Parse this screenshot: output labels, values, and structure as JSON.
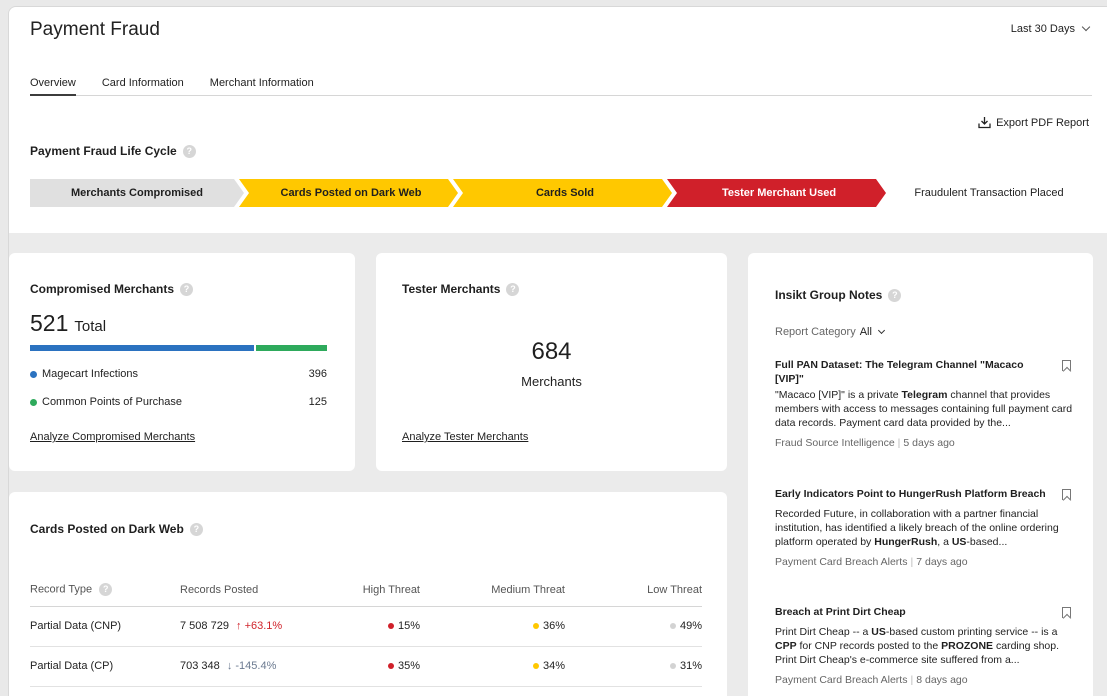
{
  "header": {
    "title": "Payment Fraud",
    "date_range": "Last 30 Days"
  },
  "tabs": [
    {
      "label": "Overview",
      "active": true
    },
    {
      "label": "Card Information",
      "active": false
    },
    {
      "label": "Merchant Information",
      "active": false
    }
  ],
  "export_label": "Export PDF Report",
  "lifecycle": {
    "title": "Payment Fraud Life Cycle",
    "stages": [
      {
        "label": "Merchants Compromised",
        "color": "#e0e0e0",
        "text_color": "#1f1f1f"
      },
      {
        "label": "Cards Posted on Dark Web",
        "color": "#ffc800",
        "text_color": "#1f1f1f"
      },
      {
        "label": "Cards Sold",
        "color": "#ffc800",
        "text_color": "#1f1f1f"
      },
      {
        "label": "Tester Merchant Used",
        "color": "#d0202a",
        "text_color": "#ffffff"
      },
      {
        "label": "Fraudulent Transaction Placed",
        "color": "#ffffff",
        "text_color": "#1f1f1f"
      }
    ]
  },
  "compromised": {
    "title": "Compromised Merchants",
    "total": "521",
    "total_label": "Total",
    "items": [
      {
        "label": "Magecart Infections",
        "value": "396",
        "color": "#2b72c0"
      },
      {
        "label": "Common Points of Purchase",
        "value": "125",
        "color": "#2eaa5c"
      }
    ],
    "link": "Analyze Compromised Merchants"
  },
  "tester": {
    "title": "Tester Merchants",
    "value": "684",
    "label": "Merchants",
    "link": "Analyze Tester Merchants"
  },
  "dark_web": {
    "title": "Cards Posted on Dark Web",
    "columns": [
      "Record Type",
      "Records Posted",
      "High Threat",
      "Medium Threat",
      "Low Threat"
    ],
    "rows": [
      {
        "type": "Partial Data (CNP)",
        "posted": "7 508 729",
        "arrow": "↑",
        "change": "+63.1%",
        "trend": "up",
        "high": "15%",
        "medium": "36%",
        "low": "49%"
      },
      {
        "type": "Partial Data (CP)",
        "posted": "703 348",
        "arrow": "↓",
        "change": "-145.4%",
        "trend": "down",
        "high": "35%",
        "medium": "34%",
        "low": "31%"
      }
    ],
    "threat_colors": {
      "high": "#d0202a",
      "medium": "#ffc800",
      "low": "#d3d3d3"
    }
  },
  "notes": {
    "title": "Insikt Group Notes",
    "category_label": "Report Category",
    "category_value": "All",
    "items": [
      {
        "title": "Full PAN Dataset: The Telegram Channel \"Macaco [VIP]\"",
        "body_parts": [
          "\"Macaco [VIP]\" is a private ",
          "Telegram",
          " channel that provides members with access to messages containing full payment card data records. Payment card data provided by the..."
        ],
        "source": "Fraud Source Intelligence",
        "age": "5 days ago"
      },
      {
        "title": "Early Indicators Point to HungerRush Platform Breach",
        "body_parts": [
          "Recorded Future, in collaboration with a partner financial institution, has identified a likely breach of the online ordering platform operated by ",
          "HungerRush",
          ", a ",
          "US",
          "-based..."
        ],
        "source": "Payment Card Breach Alerts",
        "age": "7 days ago"
      },
      {
        "title": "Breach at Print Dirt Cheap",
        "body_parts": [
          "Print Dirt Cheap -- a ",
          "US",
          "-based custom printing service -- is a ",
          "CPP",
          " for CNP records posted to the ",
          "PROZONE",
          " carding shop. Print Dirt Cheap's e-commerce site suffered from a..."
        ],
        "source": "Payment Card Breach Alerts",
        "age": "8 days ago"
      }
    ]
  }
}
